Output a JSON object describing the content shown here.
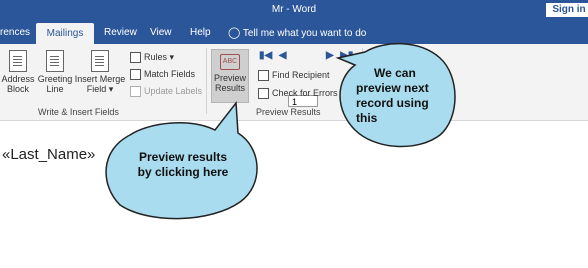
{
  "titlebar": {
    "title": "Mr  -  Word",
    "signin": "Sign in"
  },
  "tabs": [
    {
      "label": "rences"
    },
    {
      "label": "Mailings",
      "active": true
    },
    {
      "label": "Review"
    },
    {
      "label": "View"
    },
    {
      "label": "Help"
    }
  ],
  "tell_me": "Tell me what you want to do",
  "ribbon": {
    "address_block": [
      "Address",
      "Block"
    ],
    "greeting_line": [
      "Greeting",
      "Line"
    ],
    "insert_merge_field": [
      "Insert Merge",
      "Field"
    ],
    "rules": "Rules",
    "match_fields": "Match Fields",
    "update_labels": "Update Labels",
    "group_write_insert": "Write & Insert Fields",
    "preview_results": [
      "Preview",
      "Results"
    ],
    "record_number": "1",
    "find_recipient": "Find Recipient",
    "check_for_errors": "Check for Errors",
    "group_preview": "Preview Results"
  },
  "document": {
    "merge_field": "«Last_Name»"
  },
  "callouts": {
    "preview_note": [
      "Preview results",
      "by clicking here"
    ],
    "next_record_note": [
      "We can",
      "preview next",
      "record using",
      "this"
    ]
  },
  "colors": {
    "brand": "#2b579a",
    "callout_fill": "#a9dcee",
    "ribbon_bg": "#f3f3f3"
  }
}
